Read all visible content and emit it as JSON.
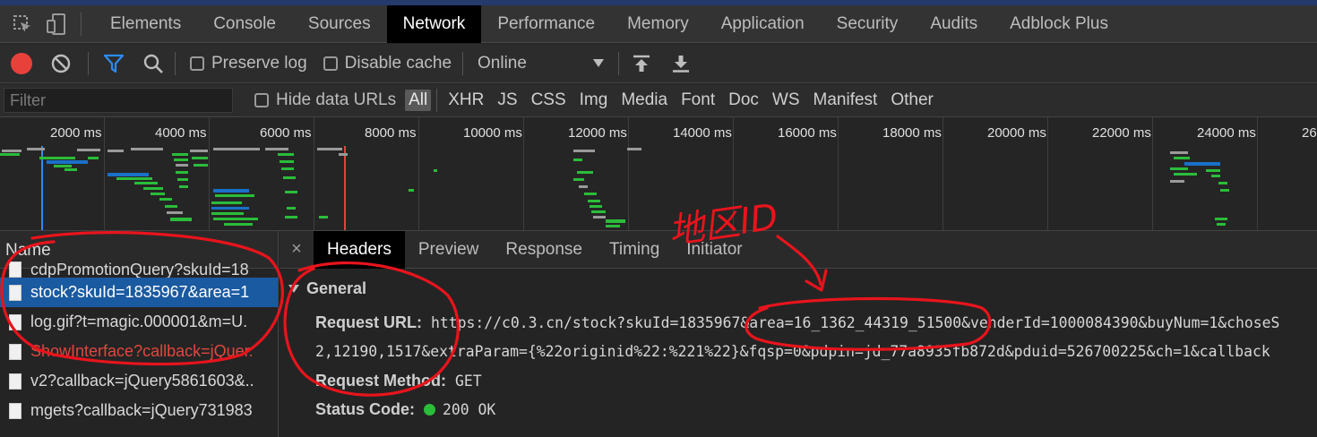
{
  "tabs": [
    "Elements",
    "Console",
    "Sources",
    "Network",
    "Performance",
    "Memory",
    "Application",
    "Security",
    "Audits",
    "Adblock Plus"
  ],
  "active_tab": "Network",
  "toolbar": {
    "preserve_log": "Preserve log",
    "disable_cache": "Disable cache",
    "throttle": "Online"
  },
  "filter": {
    "placeholder": "Filter",
    "hide_data_urls": "Hide data URLs",
    "types": [
      "All",
      "XHR",
      "JS",
      "CSS",
      "Img",
      "Media",
      "Font",
      "Doc",
      "WS",
      "Manifest",
      "Other"
    ]
  },
  "timeline": {
    "ticks": [
      "2000 ms",
      "4000 ms",
      "6000 ms",
      "8000 ms",
      "10000 ms",
      "12000 ms",
      "14000 ms",
      "16000 ms",
      "18000 ms",
      "20000 ms",
      "22000 ms",
      "24000 ms",
      "26"
    ]
  },
  "requests": {
    "header": "Name",
    "items": [
      {
        "name": "cdpPromotionQuery?skuId=18",
        "state": "cut"
      },
      {
        "name": "stock?skuId=1835967&area=1",
        "state": "selected"
      },
      {
        "name": "log.gif?t=magic.000001&m=U.",
        "state": "normal"
      },
      {
        "name": "ShowInterface?callback=jQuer.",
        "state": "error"
      },
      {
        "name": "v2?callback=jQuery5861603&..",
        "state": "normal"
      },
      {
        "name": "mgets?callback=jQuery731983",
        "state": "normal"
      }
    ]
  },
  "details": {
    "tabs": [
      "Headers",
      "Preview",
      "Response",
      "Timing",
      "Initiator"
    ],
    "active": "Headers",
    "close": "×",
    "general_title": "General",
    "url_label": "Request URL:",
    "url_line1": "https://c0.3.cn/stock?skuId=1835967&area=16_1362_44319_51500&venderId=1000084390&buyNum=1&choseS",
    "url_line2": "2,12190,1517&extraParam={%22originid%22:%221%22}&fqsp=0&pdpin=jd_77a8935fb872d&pduid=526700225&ch=1&callback",
    "method_label": "Request Method:",
    "method_value": "GET",
    "status_label": "Status Code:",
    "status_value": "200 OK"
  },
  "annotation": {
    "text": "地区ID",
    "color": "#e8141c"
  }
}
